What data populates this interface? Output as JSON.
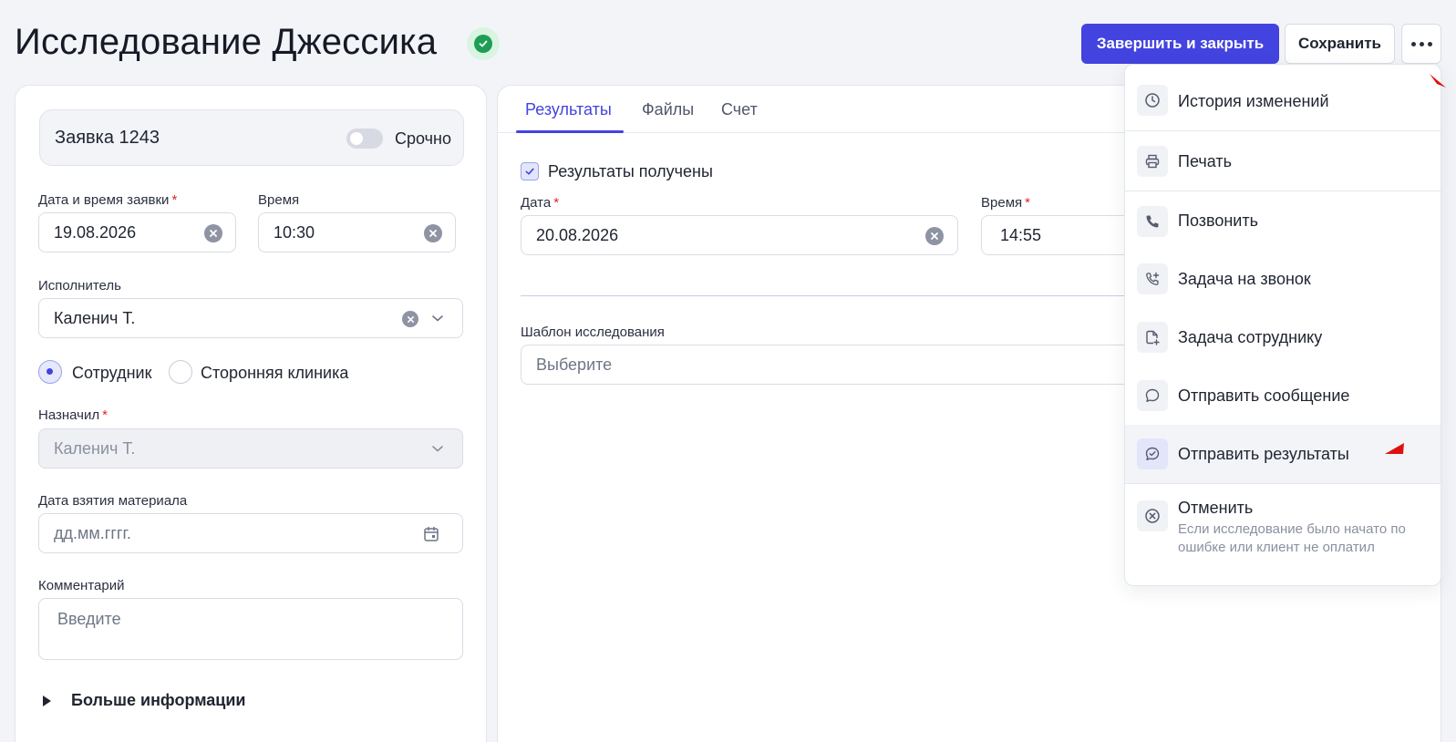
{
  "header": {
    "title": "Исследование Джессика",
    "complete_label": "Завершить и закрыть",
    "save_label": "Сохранить"
  },
  "left": {
    "request_title": "Заявка 1243",
    "urgent_label": "Срочно",
    "date_label": "Дата и время заявки",
    "date_value": "19.08.2026",
    "time_label": "Время",
    "time_value": "10:30",
    "executor_label": "Исполнитель",
    "executor_value": "Каленич Т.",
    "radio_employee": "Сотрудник",
    "radio_clinic": "Сторонняя клиника",
    "assigned_label": "Назначил",
    "assigned_value": "Каленич Т.",
    "material_label": "Дата взятия материала",
    "material_placeholder": "дд.мм.гггг.",
    "comment_label": "Комментарий",
    "comment_placeholder": "Введите",
    "more_info": "Больше информации"
  },
  "right": {
    "tabs": [
      "Результаты",
      "Файлы",
      "Счет"
    ],
    "results_received": "Результаты получены",
    "date_label": "Дата",
    "date_value": "20.08.2026",
    "time_label": "Время",
    "time_value": "14:55",
    "template_label": "Шаблон исследования",
    "template_placeholder": "Выберите"
  },
  "menu": {
    "items": [
      {
        "label": "История изменений",
        "icon": "clock-icon"
      },
      {
        "label": "Печать",
        "icon": "printer-icon"
      },
      {
        "label": "Позвонить",
        "icon": "phone-icon"
      },
      {
        "label": "Задача на звонок",
        "icon": "phone-plus-icon"
      },
      {
        "label": "Задача сотруднику",
        "icon": "file-plus-icon"
      },
      {
        "label": "Отправить сообщение",
        "icon": "message-icon"
      },
      {
        "label": "Отправить результаты",
        "icon": "message-check-icon"
      },
      {
        "label": "Отменить",
        "icon": "cancel-icon",
        "description": "Если исследование было начато по ошибке или клиент не оплатил"
      }
    ]
  },
  "colors": {
    "accent": "#4343e0",
    "success": "#1e9e55",
    "required": "#e02424"
  }
}
